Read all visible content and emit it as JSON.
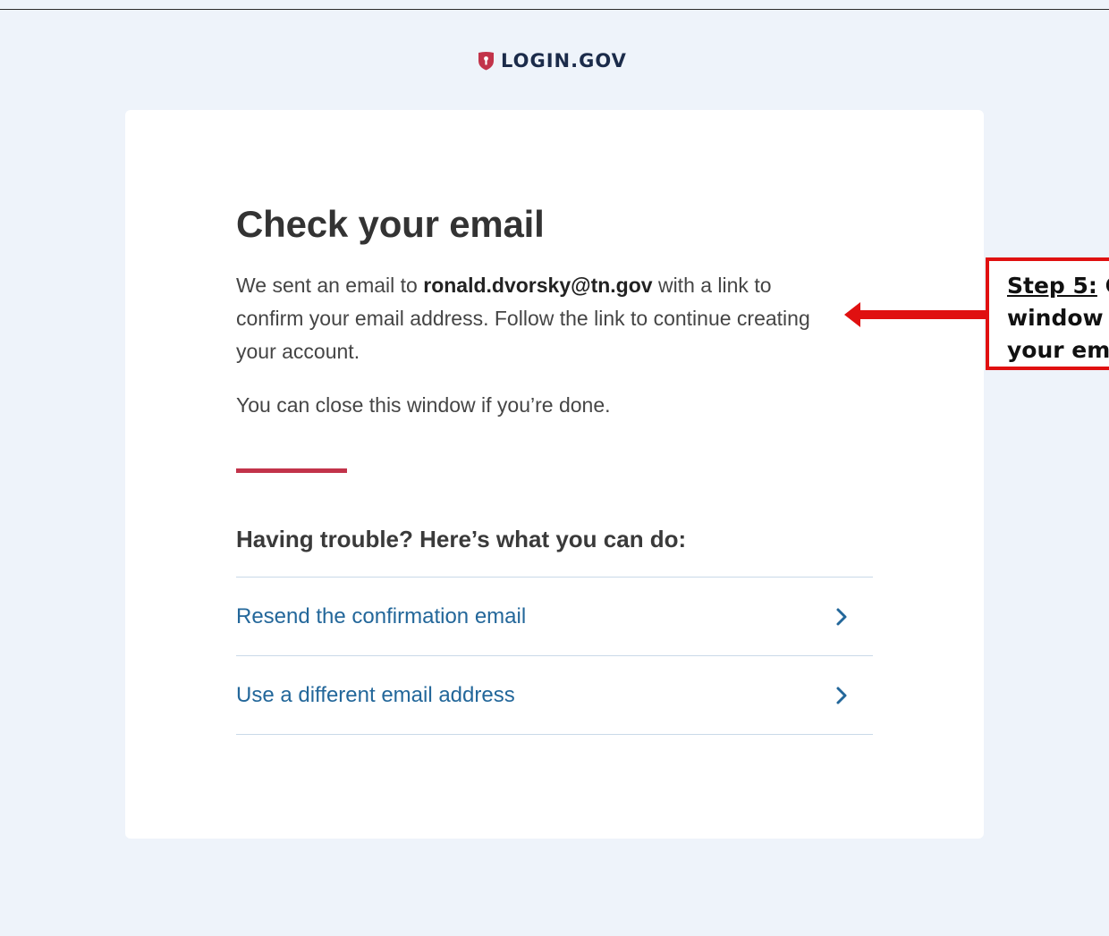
{
  "header": {
    "logo_text": "LOGIN.GOV",
    "logo_icon": "shield-icon",
    "brand_color": "#c2334a"
  },
  "main": {
    "title": "Check your email",
    "intro_prefix": "We sent an email to ",
    "email": "ronald.dvorsky@tn.gov",
    "intro_suffix": " with a link to confirm your email address. Follow the link to continue creating your account.",
    "close_note": "You can close this window if you’re done.",
    "trouble_heading": "Having trouble? Here’s what you can do:",
    "options": [
      {
        "label": "Resend the confirmation email",
        "icon": "chevron-right-icon"
      },
      {
        "label": "Use a different email address",
        "icon": "chevron-right-icon"
      }
    ]
  },
  "annotation": {
    "step_label": "Step 5:",
    "step_text_1": " C",
    "line_2": "window",
    "line_3": "your em",
    "color": "#e01010"
  }
}
